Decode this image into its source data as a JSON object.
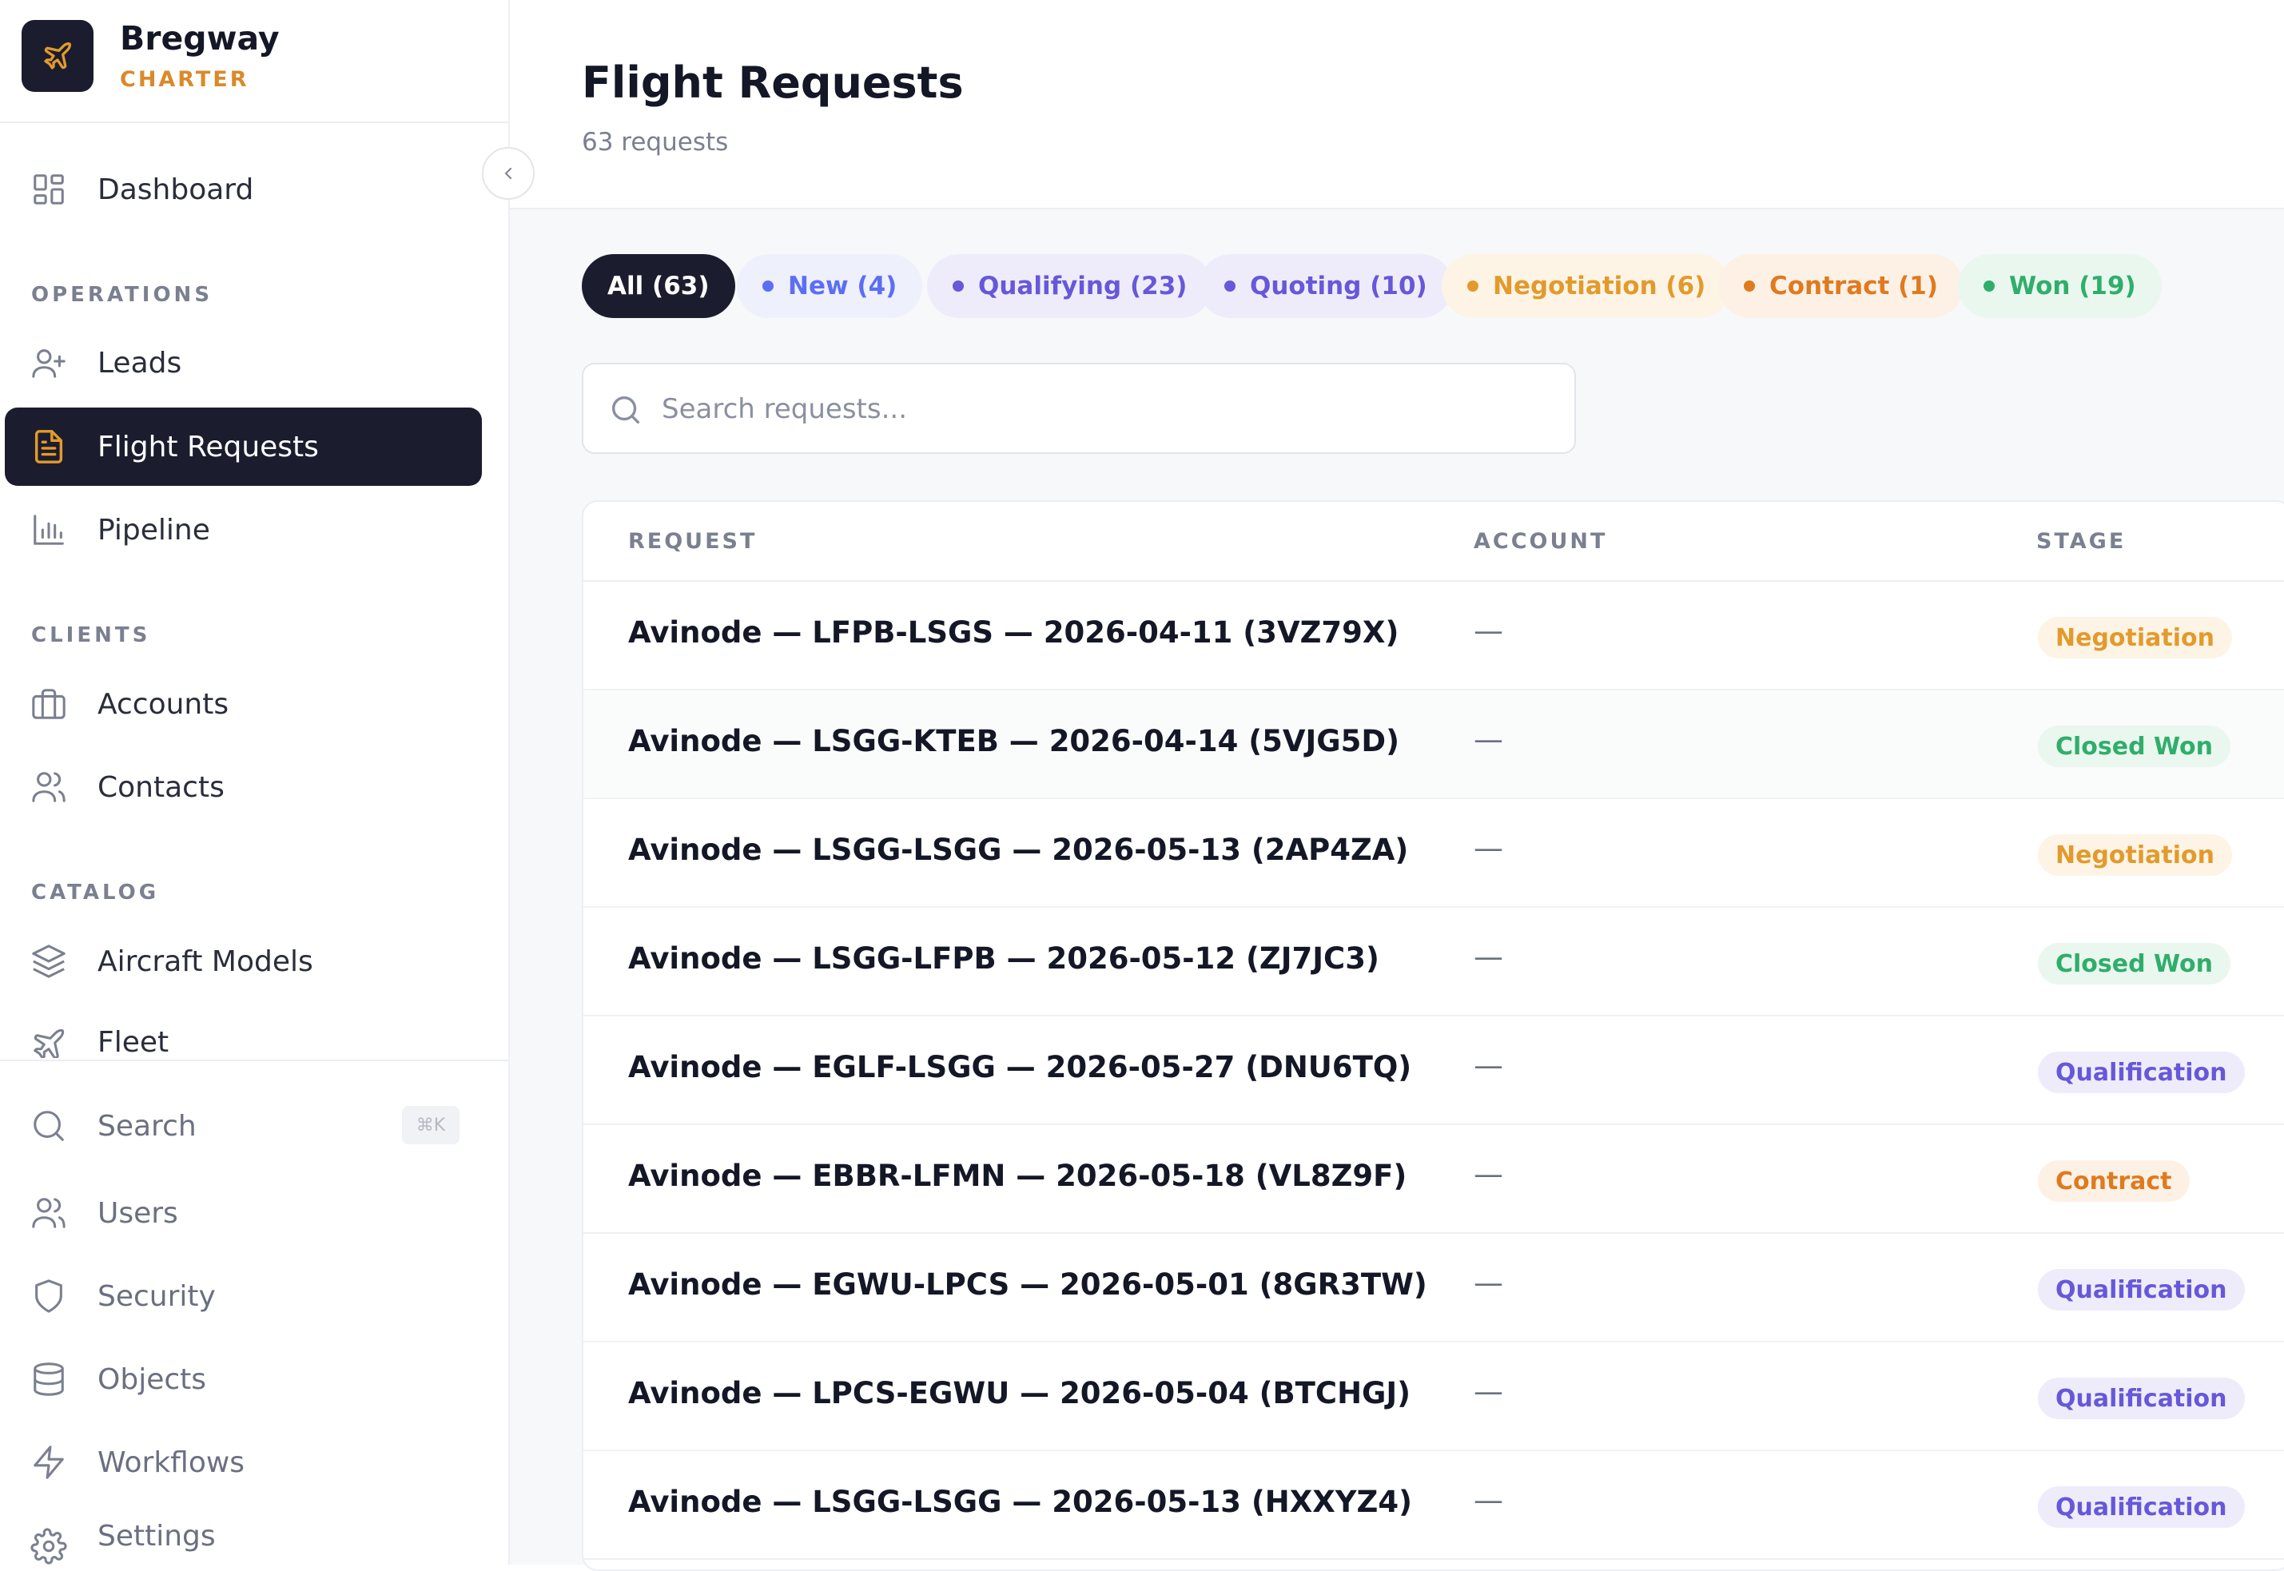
{
  "brand": {
    "name": "Bregway",
    "sub": "CHARTER"
  },
  "sidebar": {
    "dashboard": "Dashboard",
    "sections": {
      "operations": "OPERATIONS",
      "clients": "CLIENTS",
      "catalog": "CATALOG"
    },
    "operations": [
      "Leads",
      "Flight Requests",
      "Pipeline"
    ],
    "clients": [
      "Accounts",
      "Contacts"
    ],
    "catalog": [
      "Aircraft Models",
      "Fleet"
    ],
    "bottom": {
      "search": "Search",
      "search_shortcut": "⌘K",
      "users": "Users",
      "security": "Security",
      "objects": "Objects",
      "workflows": "Workflows",
      "settings": "Settings"
    }
  },
  "header": {
    "title": "Flight Requests",
    "subtitle": "63 requests"
  },
  "filters": [
    "All (63)",
    "New (4)",
    "Qualifying (23)",
    "Quoting (10)",
    "Negotiation (6)",
    "Contract (1)",
    "Won (19)"
  ],
  "search": {
    "placeholder": "Search requests..."
  },
  "table": {
    "columns": [
      "REQUEST",
      "ACCOUNT",
      "STAGE"
    ],
    "rows": [
      {
        "request": "Avinode — LFPB-LSGS — 2026-04-11 (3VZ79X)",
        "account": "—",
        "stage": "Negotiation"
      },
      {
        "request": "Avinode — LSGG-KTEB — 2026-04-14 (5VJG5D)",
        "account": "—",
        "stage": "Closed Won"
      },
      {
        "request": "Avinode — LSGG-LSGG — 2026-05-13 (2AP4ZA)",
        "account": "—",
        "stage": "Negotiation"
      },
      {
        "request": "Avinode — LSGG-LFPB — 2026-05-12 (ZJ7JC3)",
        "account": "—",
        "stage": "Closed Won"
      },
      {
        "request": "Avinode — EGLF-LSGG — 2026-05-27 (DNU6TQ)",
        "account": "—",
        "stage": "Qualification"
      },
      {
        "request": "Avinode — EBBR-LFMN — 2026-05-18 (VL8Z9F)",
        "account": "—",
        "stage": "Contract"
      },
      {
        "request": "Avinode — EGWU-LPCS — 2026-05-01 (8GR3TW)",
        "account": "—",
        "stage": "Qualification"
      },
      {
        "request": "Avinode — LPCS-EGWU — 2026-05-04 (BTCHGJ)",
        "account": "—",
        "stage": "Qualification"
      },
      {
        "request": "Avinode — LSGG-LSGG — 2026-05-13 (HXXYZ4)",
        "account": "—",
        "stage": "Qualification"
      }
    ]
  },
  "colors": {
    "sidebar_active": "#1b1d2e",
    "brand_accent": "#d98a2b",
    "new": "#5b6ef5",
    "qualifying": "#6658d9",
    "negotiation": "#e39a2c",
    "contract": "#e07a1f",
    "won": "#2fae6b"
  },
  "icons": {
    "brand": "plane-icon",
    "dashboard": "grid-icon",
    "leads": "user-plus-icon",
    "flight_requests": "document-icon",
    "pipeline": "bar-chart-icon",
    "accounts": "briefcase-icon",
    "contacts": "users-icon",
    "aircraft_models": "layers-icon",
    "fleet": "plane-icon",
    "search": "search-icon",
    "users": "users-icon",
    "security": "shield-icon",
    "objects": "database-icon",
    "workflows": "zap-icon",
    "settings": "gear-icon",
    "collapse": "chevron-left-icon"
  }
}
